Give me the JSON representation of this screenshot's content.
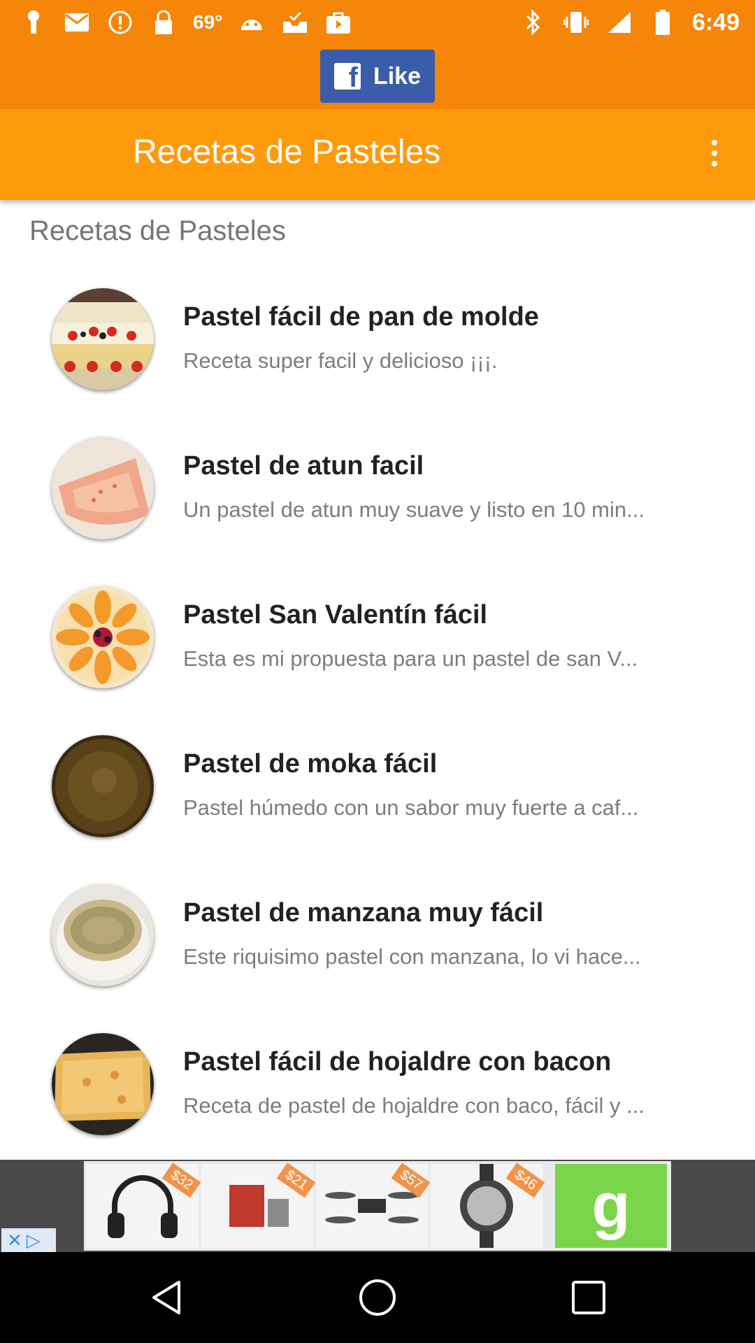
{
  "status_bar": {
    "temperature": "69°",
    "time": "6:49"
  },
  "fb_like": {
    "label": "Like"
  },
  "app_bar": {
    "title": "Recetas de Pasteles"
  },
  "section_title": "Recetas de Pasteles",
  "recipes": [
    {
      "title": "Pastel fácil de pan de molde",
      "desc": "Receta super facil y delicioso ¡¡¡."
    },
    {
      "title": "Pastel de atun facil",
      "desc": "Un pastel de atun muy suave y listo en 10 min..."
    },
    {
      "title": "Pastel San Valentín fácil",
      "desc": "Esta es mi propuesta para un pastel de san V..."
    },
    {
      "title": "Pastel de moka fácil",
      "desc": "Pastel húmedo con un sabor muy fuerte a caf..."
    },
    {
      "title": "Pastel de manzana muy fácil",
      "desc": "Este riquisimo pastel con manzana, lo vi hace..."
    },
    {
      "title": "Pastel fácil de hojaldre con bacon",
      "desc": "Receta de pastel de hojaldre con baco, fácil y ..."
    }
  ],
  "ad": {
    "prices": [
      "$32",
      "$21",
      "$57",
      "$46"
    ],
    "cta_label": "g"
  }
}
